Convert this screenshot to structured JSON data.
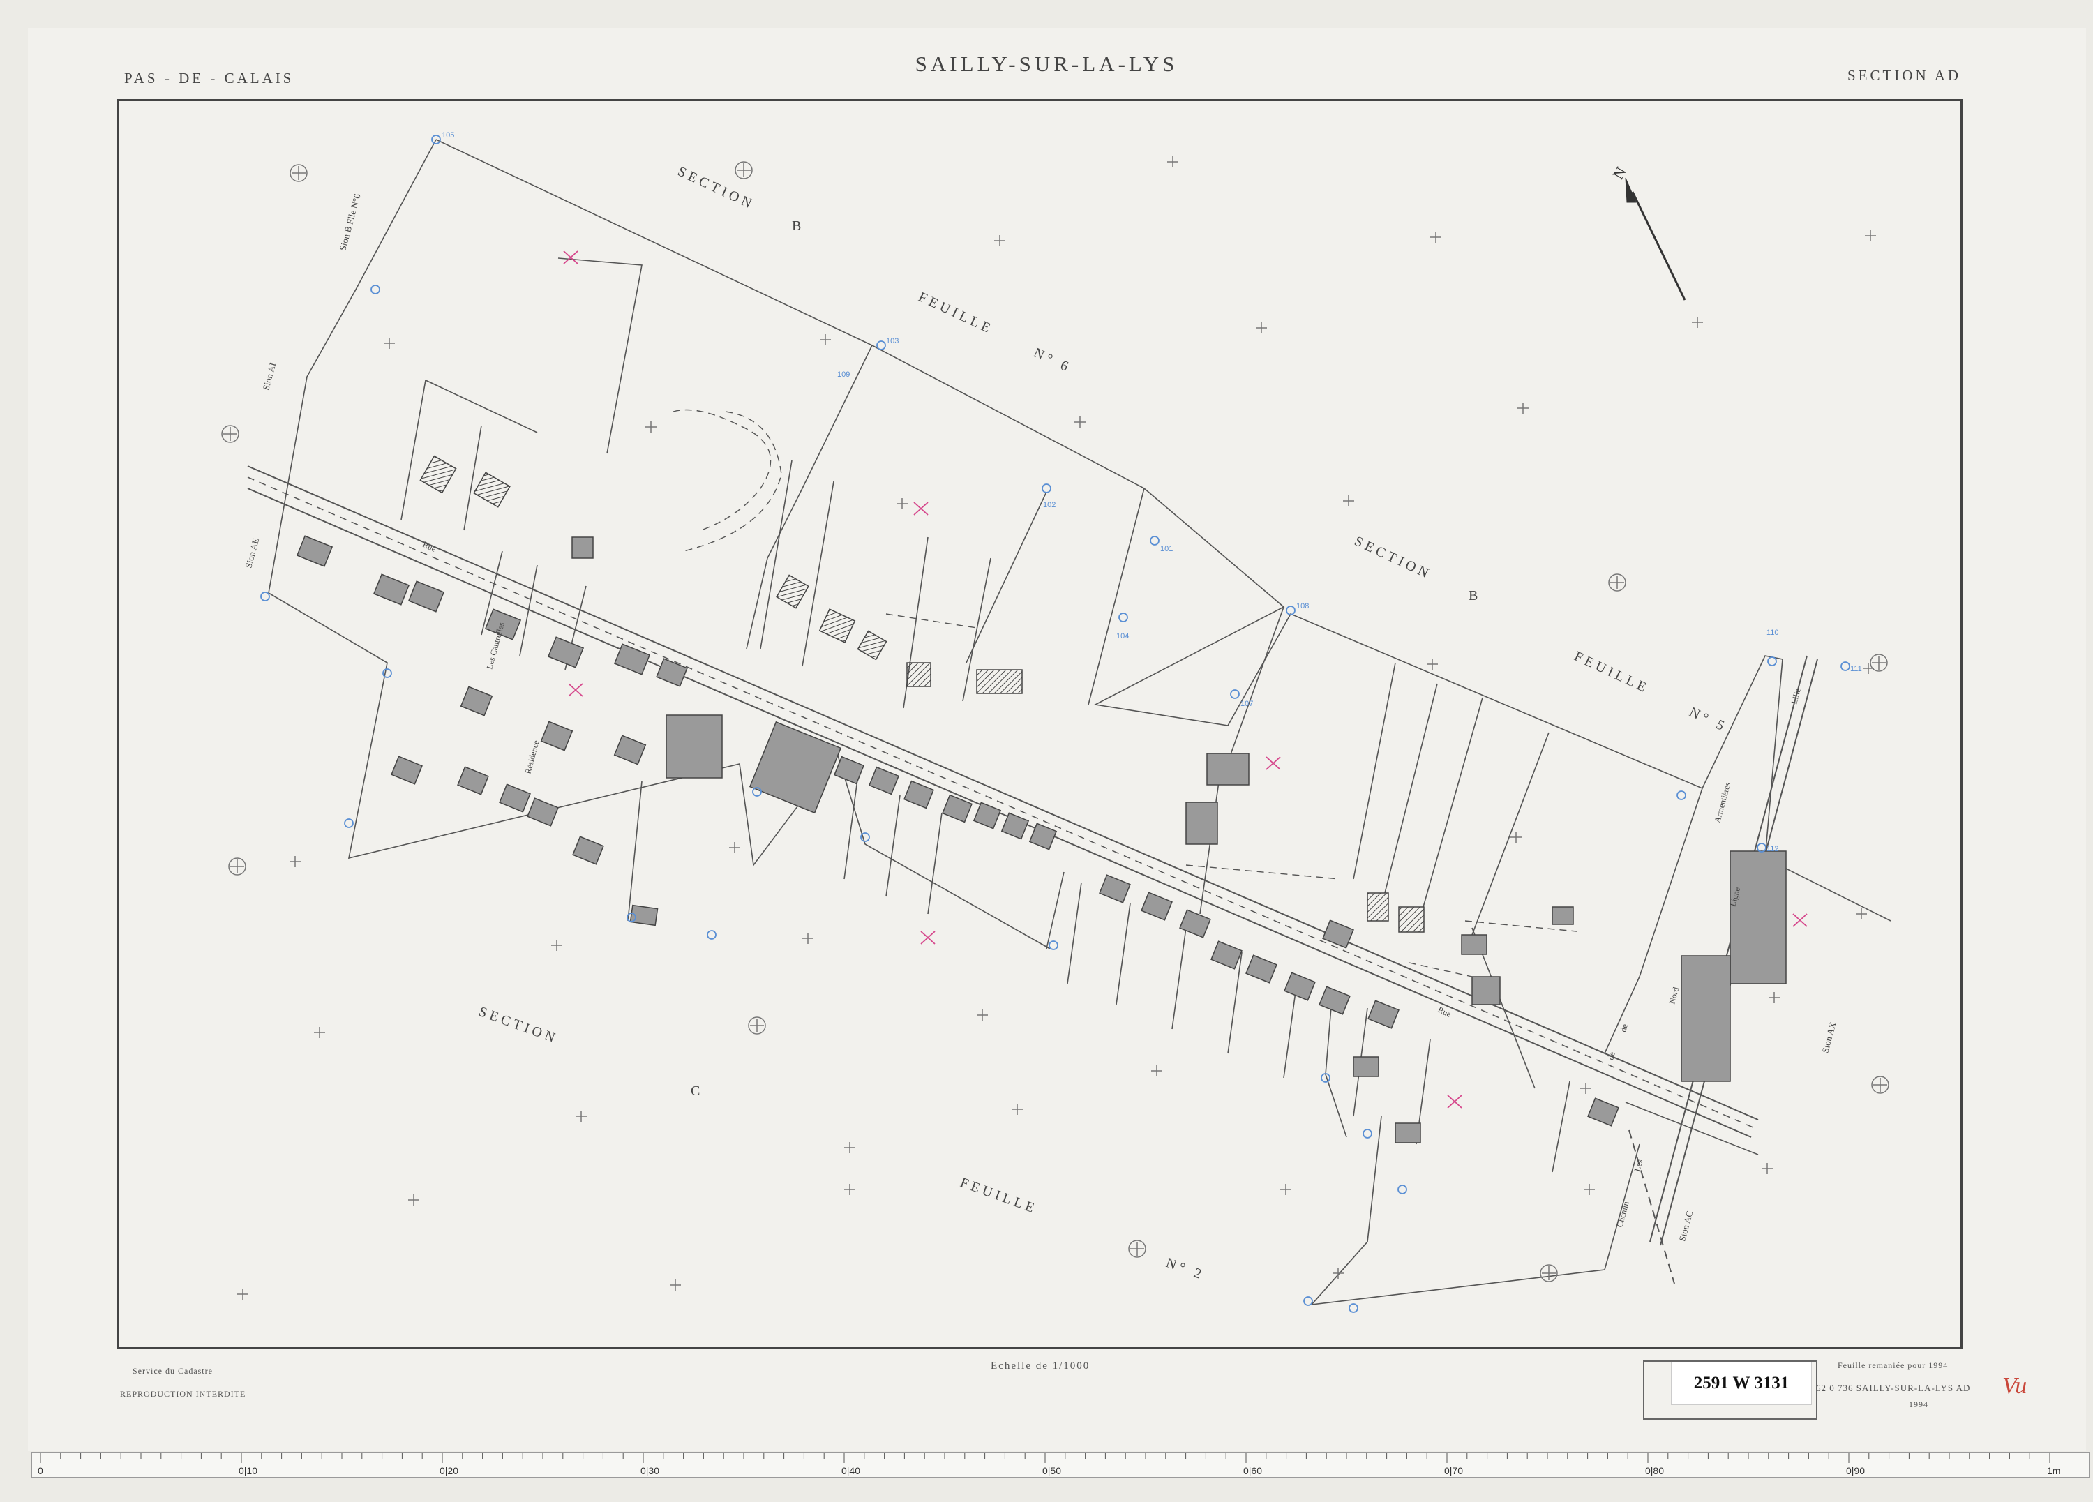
{
  "header": {
    "department": "PAS - DE - CALAIS",
    "commune": "SAILLY-SUR-LA-LYS",
    "section": "SECTION  AD"
  },
  "north_arrow": {
    "label": "N"
  },
  "section_labels": [
    {
      "text": "SECTION"
    },
    {
      "text": "B"
    },
    {
      "text": "FEUILLE"
    },
    {
      "text": "N° 6"
    },
    {
      "text": "SECTION"
    },
    {
      "text": "B"
    },
    {
      "text": "FEUILLE"
    },
    {
      "text": "N° 5"
    },
    {
      "text": "SECTION"
    },
    {
      "text": "C"
    },
    {
      "text": "FEUILLE"
    },
    {
      "text": "N° 2"
    }
  ],
  "neighbour_sections": [
    "Sion AI",
    "Sion B Flle N°6",
    "Sion AE",
    "Sion AX",
    "Sion AC"
  ],
  "streets": [
    "Rue",
    "Les Cantrelles",
    "Résidence",
    "Ligne",
    "de",
    "Nord",
    "Armentières",
    "Rue",
    "de",
    "Lille",
    "Chemin",
    "Les"
  ],
  "grid_points": [
    "105",
    "103",
    "102",
    "101",
    "108",
    "110",
    "111",
    "112",
    "107",
    "109",
    "104"
  ],
  "footer": {
    "service": "Service du Cadastre",
    "reproduction": "REPRODUCTION  INTERDITE",
    "scale": "Echelle de 1/1000",
    "remaniee": "Feuille remaniée pour 1994",
    "commune_ref": "62 0 736  SAILLY-SUR-LA-LYS  AD",
    "year": "1994"
  },
  "archive_label": "2591 W 3131",
  "annotation": "Vu",
  "ruler": {
    "major_labels": [
      "0",
      "0|10",
      "0|20",
      "0|30",
      "0|40",
      "0|50",
      "0|60",
      "0|70",
      "0|80",
      "0|90",
      "1m"
    ]
  },
  "colors": {
    "paper": "#f2f1ed",
    "ink": "#444444",
    "blue_annotations": "#5a8fd4",
    "pink_annotations": "#d6488c",
    "building_fill": "#9a9a9a"
  }
}
